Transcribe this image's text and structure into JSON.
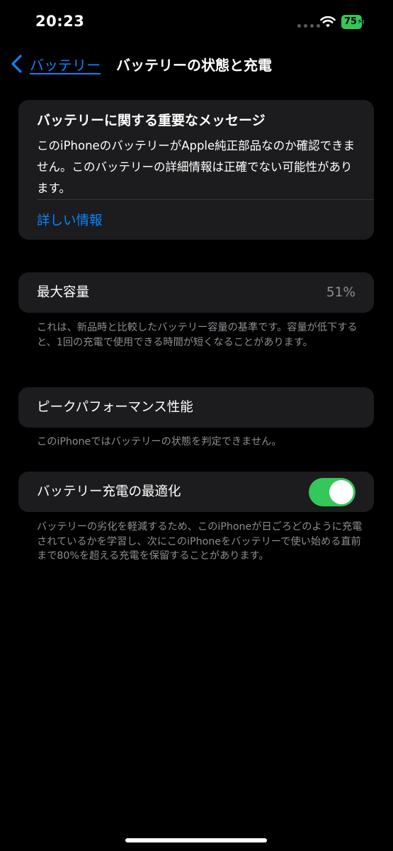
{
  "status_bar": {
    "time": "20:23",
    "battery_level": "75",
    "battery_color": "#34c759"
  },
  "nav": {
    "back_label": "バッテリー",
    "title": "バッテリーの状態と充電"
  },
  "alert": {
    "title": "バッテリーに関する重要なメッセージ",
    "body": "このiPhoneのバッテリーがApple純正部品なのか確認できません。このバッテリーの詳細情報は正確でない可能性があります。",
    "link": "詳しい情報"
  },
  "max_capacity": {
    "label": "最大容量",
    "value": "51%",
    "note": "これは、新品時と比較したバッテリー容量の基準です。容量が低下すると、1回の充電で使用できる時間が短くなることがあります。"
  },
  "peak_performance": {
    "label": "ピークパフォーマンス性能",
    "note": "このiPhoneではバッテリーの状態を判定できません。"
  },
  "optimized_charging": {
    "label": "バッテリー充電の最適化",
    "enabled": true,
    "toggle_color": "#34c759",
    "note": "バッテリーの劣化を軽減するため、このiPhoneが日ごろどのように充電されているかを学習し、次にこのiPhoneをバッテリーで使い始める直前まで80%を超える充電を保留することがあります。"
  },
  "colors": {
    "accent": "#0a84ff",
    "background": "#000000",
    "card": "#1c1c1e",
    "secondary_text": "#8e8e93"
  },
  "icons": [
    "signal-dots-icon",
    "wifi-icon",
    "battery-icon",
    "charging-bolt-icon",
    "back-chevron-icon"
  ]
}
